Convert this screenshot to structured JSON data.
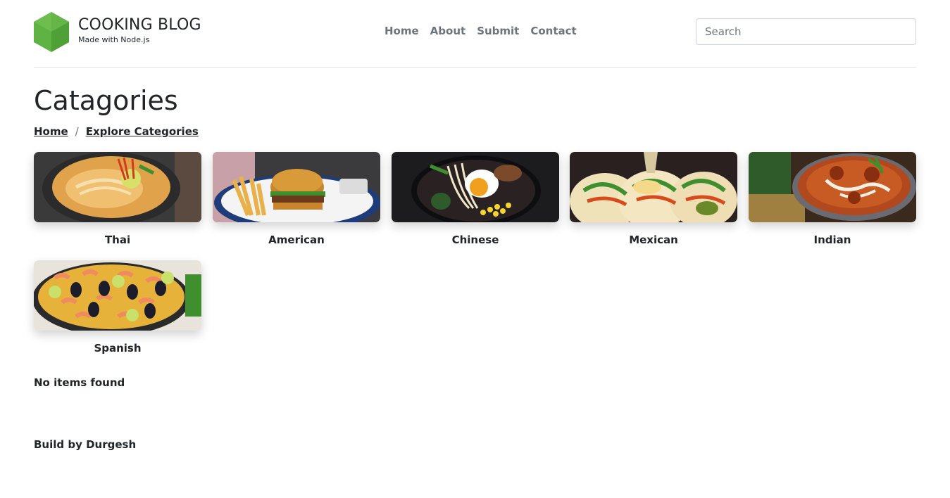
{
  "brand": {
    "title": "COOKING BLOG",
    "subtitle": "Made with Node.js"
  },
  "nav": {
    "items": [
      "Home",
      "About",
      "Submit",
      "Contact"
    ]
  },
  "search": {
    "placeholder": "Search"
  },
  "page": {
    "title": "Catagories"
  },
  "breadcrumb": {
    "home": "Home",
    "separator": "/",
    "current": "Explore Categories"
  },
  "categories": [
    {
      "label": "Thai"
    },
    {
      "label": "American"
    },
    {
      "label": "Chinese"
    },
    {
      "label": "Mexican"
    },
    {
      "label": "Indian"
    },
    {
      "label": "Spanish"
    }
  ],
  "status": {
    "empty_message": "No items found"
  },
  "footer": {
    "text": "Build by Durgesh"
  },
  "colors": {
    "logo_green": "#5fb342",
    "nav_text": "#6c757d",
    "text": "#212529",
    "border": "#dee2e6"
  }
}
